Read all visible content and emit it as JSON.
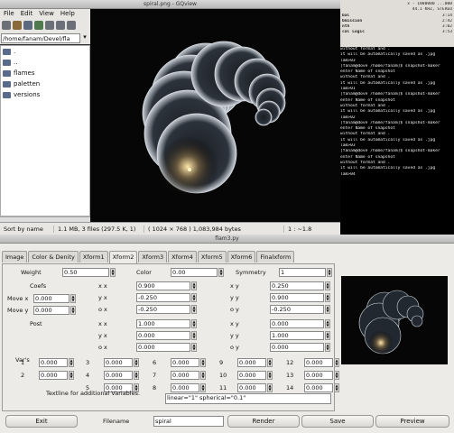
{
  "gqview": {
    "title": "spiral.png - GQview",
    "menu": [
      "File",
      "Edit",
      "View",
      "Help"
    ],
    "path": "/home/fanam/Devel/fla",
    "tree": [
      ".",
      "..",
      "flames",
      "paletten",
      "versions"
    ],
    "status": {
      "sort": "Sort by name",
      "info": "1.1 MB, 3 files (297.5 K, 1)",
      "dims": "( 1024 × 768 ) 1,083,984 bytes",
      "zoom": "1 : ~1.8"
    }
  },
  "terminal": {
    "top_lines": [
      {
        "a": "",
        "b": "x - 1000000 ...000"
      },
      {
        "a": "",
        "b": "44.1 KHZ, STEREO"
      },
      {
        "a": "bal",
        "b": "3:14"
      },
      {
        "a": "bmission",
        "b": "2:42"
      },
      {
        "a": "nth",
        "b": "3:02"
      },
      {
        "a": "cal Logic",
        "b": "3:53"
      }
    ],
    "lines": [
      "without format and .",
      "it will be automatically saved as .jpg",
      "lam>03",
      "[fanam@dove /home/fanam]$ snapshot-maker",
      "enter Name of snapshot",
      "without format and .",
      "it will be automatically saved as .jpg",
      "lam>01",
      "[fanam@dove /home/fanam]$ snapshot-maker",
      "enter Name of snapshot",
      "without format and .",
      "it will be automatically saved as .jpg",
      "lam>02",
      "[fanam@dove /home/fanam]$ snapshot-maker",
      "enter Name of snapshot",
      "without format and .",
      "it will be automatically saved as .jpg",
      "lam>03",
      "[fanam@dove /home/fanam]$ snapshot-maker",
      "enter Name of snapshot",
      "without format and .",
      "it will be automatically saved as .jpg",
      "lam>04"
    ]
  },
  "flam3": {
    "title": "flam3.py",
    "tabs": [
      "Image",
      "Color & Denity",
      "Xform1",
      "Xform2",
      "Xform3",
      "Xform4",
      "Xform5",
      "Xform6",
      "Finalxform"
    ],
    "active_tab": "Xform2",
    "weight_label": "Weight",
    "weight": "0.50",
    "color_label": "Color",
    "color": "0.00",
    "symmetry_label": "Symmetry",
    "symmetry": "1",
    "coefs_label": "Coefs",
    "movex_label": "Move x",
    "movex": "0.000",
    "movey_label": "Move y",
    "movey": "0.000",
    "xx_label": "x x",
    "xx": "0.900",
    "yx_label": "y x",
    "yx": "-0.250",
    "ox_label": "o x",
    "ox": "-0.250",
    "xy_label": "x y",
    "xy": "0.250",
    "yy_label": "y y",
    "yy": "0.900",
    "oy_label": "o y",
    "oy": "-0.250",
    "post_label": "Post",
    "pxx_label": "x x",
    "pxx": "1.000",
    "pyx_label": "y x",
    "pyx": "0.000",
    "pox_label": "o x",
    "pox": "0.000",
    "pxy_label": "x y",
    "pxy": "0.000",
    "pyy_label": "y y",
    "pyy": "1.000",
    "poy_label": "o y",
    "poy": "0.000",
    "vars_label": "Var's",
    "vars": [
      {
        "n": "1",
        "v": "0.000"
      },
      {
        "n": "3",
        "v": "0.000"
      },
      {
        "n": "6",
        "v": "0.000"
      },
      {
        "n": "9",
        "v": "0.000"
      },
      {
        "n": "12",
        "v": "0.000"
      },
      {
        "n": "",
        "v": ""
      },
      {
        "n": "2",
        "v": "0.000"
      },
      {
        "n": "4",
        "v": "0.000"
      },
      {
        "n": "7",
        "v": "0.000"
      },
      {
        "n": "10",
        "v": "0.000"
      },
      {
        "n": "13",
        "v": "0.000"
      },
      {
        "n": "",
        "v": ""
      },
      {
        "n": "",
        "v": ""
      },
      {
        "n": "5",
        "v": "0.000"
      },
      {
        "n": "8",
        "v": "0.000"
      },
      {
        "n": "11",
        "v": "0.000"
      },
      {
        "n": "14",
        "v": "0.000"
      }
    ],
    "textline_label": "Textline for additional Variables.",
    "textline": "linear=\"1\" spherical=\"0.1\"",
    "exit": "Exit",
    "filename_label": "Filename",
    "filename": "spiral",
    "render": "Render",
    "save": "Save",
    "preview": "Preview"
  }
}
